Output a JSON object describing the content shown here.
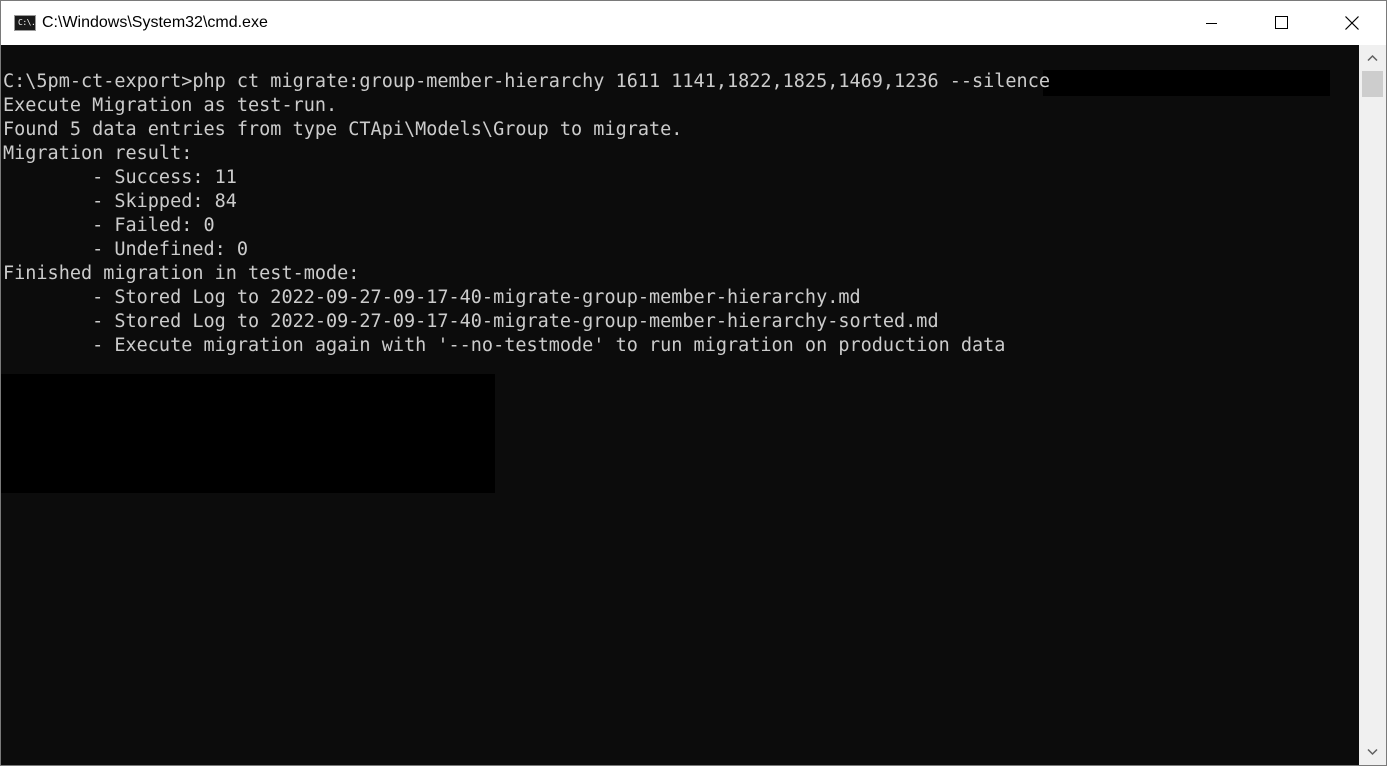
{
  "window": {
    "title": "C:\\Windows\\System32\\cmd.exe",
    "icon": "cmd-icon",
    "icon_text": "C:\\.",
    "buttons": {
      "minimize": "minimize-icon",
      "maximize": "maximize-icon",
      "close": "close-icon"
    }
  },
  "colors": {
    "console_bg": "#0c0c0c",
    "console_fg": "#cccccc",
    "titlebar_bg": "#ffffff",
    "scrollbar_bg": "#f0f0f0"
  },
  "console": {
    "lines": [
      "C:\\5pm-ct-export>php ct migrate:group-member-hierarchy 1611 1141,1822,1825,1469,1236 --silence",
      "Execute Migration as test-run.",
      "Found 5 data entries from type CTApi\\Models\\Group to migrate.",
      "Migration result:",
      "        - Success: 11",
      "        - Skipped: 84",
      "        - Failed: 0",
      "        - Undefined: 0",
      "Finished migration in test-mode:",
      "        - Stored Log to 2022-09-27-09-17-40-migrate-group-member-hierarchy.md",
      "        - Stored Log to 2022-09-27-09-17-40-migrate-group-member-hierarchy-sorted.md",
      "        - Execute migration again with '--no-testmode' to run migration on production data"
    ]
  }
}
